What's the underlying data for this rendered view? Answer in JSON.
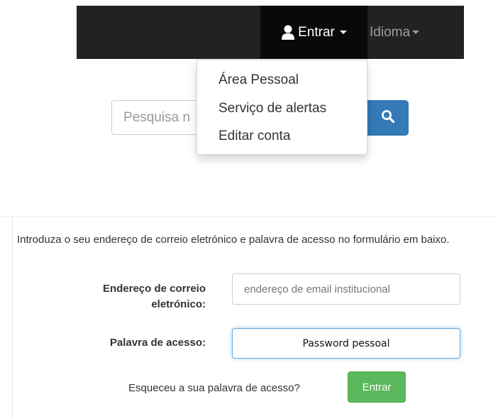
{
  "colors": {
    "navbar_bg": "#222222",
    "navbar_active_bg": "#090909",
    "nav_muted_text": "#9d9d9d",
    "search_button": "#337ab7",
    "submit_button": "#5cb85c",
    "focus_border": "#66afe9"
  },
  "navbar": {
    "entrar_label": "Entrar",
    "entrar_icon": "user-icon",
    "idioma_label": "Idioma"
  },
  "dropdown": {
    "items": [
      {
        "label": "Área Pessoal"
      },
      {
        "label": "Serviço de alertas"
      },
      {
        "label": "Editar conta"
      }
    ]
  },
  "search": {
    "visible_text": "Pesquisa n",
    "button_icon": "search-icon"
  },
  "login_form": {
    "intro": "Introduza o seu endereço de correio eletrónico e palavra de acesso no formulário em baixo.",
    "email_label_line1": "Endereço de correio",
    "email_label_line2": "eletrónico:",
    "email_placeholder": "endereço de email institucional",
    "password_label": "Palavra de acesso:",
    "password_value": "Password pessoal",
    "forgot_link": "Esqueceu a sua palavra de acesso?",
    "submit_label": "Entrar"
  }
}
